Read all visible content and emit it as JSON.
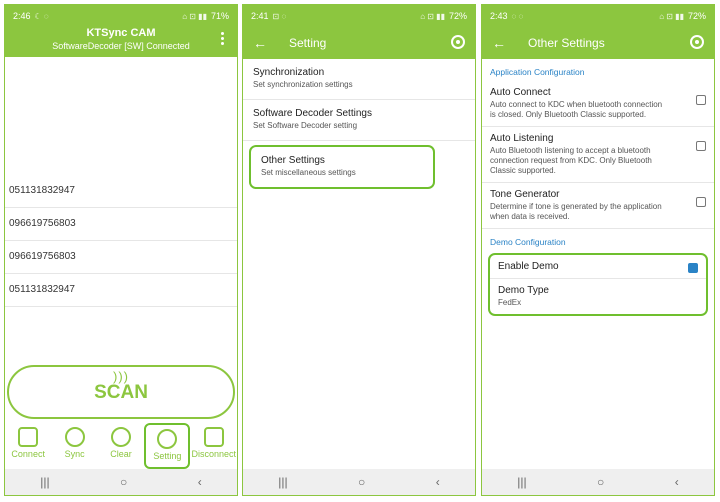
{
  "phone1": {
    "status": {
      "time": "2:46",
      "battery": "71%"
    },
    "header": {
      "title": "KTSync CAM",
      "subtitle": "SoftwareDecoder [SW] Connected"
    },
    "scans": [
      "051131832947",
      "096619756803",
      "096619756803",
      "051131832947"
    ],
    "scan_label": "SCAN",
    "toolbar": [
      {
        "label": "Connect",
        "icon": "connect-icon"
      },
      {
        "label": "Sync",
        "icon": "sync-icon"
      },
      {
        "label": "Clear",
        "icon": "trash-icon"
      },
      {
        "label": "Setting",
        "icon": "gear-icon"
      },
      {
        "label": "Disconnect",
        "icon": "disconnect-icon"
      }
    ],
    "highlight_color": "#6fbf2e"
  },
  "phone2": {
    "status": {
      "time": "2:41",
      "battery": "72%"
    },
    "appbar": {
      "title": "Setting"
    },
    "items": [
      {
        "title": "Synchronization",
        "subtitle": "Set synchronization settings"
      },
      {
        "title": "Software Decoder Settings",
        "subtitle": "Set Software Decoder setting"
      },
      {
        "title": "Other Settings",
        "subtitle": "Set miscellaneous settings"
      }
    ]
  },
  "phone3": {
    "status": {
      "time": "2:43",
      "battery": "72%"
    },
    "appbar": {
      "title": "Other Settings"
    },
    "section_app": "Application Configuration",
    "auto_connect": {
      "title": "Auto Connect",
      "subtitle": "Auto connect to KDC when bluetooth connection is closed. Only Bluetooth Classic supported."
    },
    "auto_listening": {
      "title": "Auto Listening",
      "subtitle": "Auto Bluetooth listening to accept a bluetooth connection request from KDC. Only Bluetooth Classic supported."
    },
    "tone_generator": {
      "title": "Tone Generator",
      "subtitle": "Determine if tone is generated by the application when data is received."
    },
    "section_demo": "Demo Configuration",
    "enable_demo": {
      "title": "Enable Demo"
    },
    "demo_type": {
      "title": "Demo Type",
      "value": "FedEx"
    }
  },
  "nav": {
    "recents": "|||",
    "home": "○",
    "back": "‹"
  },
  "colors": {
    "brand_green": "#8cc63f",
    "accent_blue": "#2a83c6"
  }
}
